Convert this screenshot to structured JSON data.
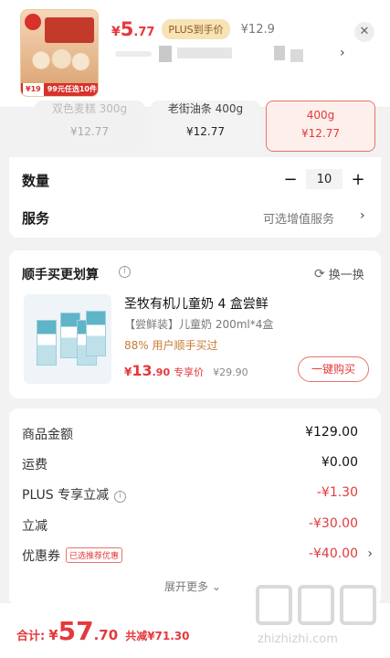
{
  "header": {
    "thumb_promo_price": "¥19",
    "thumb_promo_text": "99元任选10件",
    "price_currency": "¥",
    "price_int": "5",
    "price_dec": ".77",
    "plus_badge": "PLUS到手价",
    "original_price": "¥12.9",
    "close_glyph": "✕",
    "spec_arrow": "›"
  },
  "options": [
    {
      "name": "双色麦糕 300g",
      "price": "¥12.77",
      "state": "disabled"
    },
    {
      "name": "老街油条 400g",
      "price": "¥12.77",
      "state": "normal"
    },
    {
      "name": "400g",
      "price": "¥12.77",
      "state": "selected"
    }
  ],
  "quantity": {
    "label": "数量",
    "minus": "−",
    "value": "10",
    "plus": "+"
  },
  "service": {
    "label": "服务",
    "value": "可选增值服务",
    "arrow": "›"
  },
  "recommend": {
    "title": "顺手买更划算",
    "info": "i",
    "refresh_icon": "⟳",
    "refresh_label": "换一换",
    "product_name": "圣牧有机儿童奶 4 盒尝鲜",
    "product_sub": "【尝鲜装】儿童奶 200ml*4盒",
    "buy_percent": "88% 用户顺手买过",
    "price_currency": "¥",
    "price_int": "13",
    "price_dec": ".90",
    "price_tag": "专享价",
    "original_price": "¥29.90",
    "buy_button": "一键购买"
  },
  "summary": {
    "rows": [
      {
        "label": "商品金额",
        "value": "¥129.00"
      },
      {
        "label": "运费",
        "value": "¥0.00"
      },
      {
        "label": "PLUS 专享立减",
        "value": "-¥1.30"
      },
      {
        "label": "立减",
        "value": "-¥30.00"
      },
      {
        "label": "优惠券",
        "tag": "已选推荐优惠",
        "value": "-¥40.00"
      }
    ],
    "expand": "展开更多 ⌄"
  },
  "total": {
    "label": "合计:",
    "currency": "¥",
    "int": "57",
    "dec": ".70",
    "saved": "共减¥71.30"
  },
  "watermark": {
    "text": "zhizhizhi.com"
  },
  "colors": {
    "accent": "#e4393c",
    "plus_gold": "#f7e3b5"
  }
}
